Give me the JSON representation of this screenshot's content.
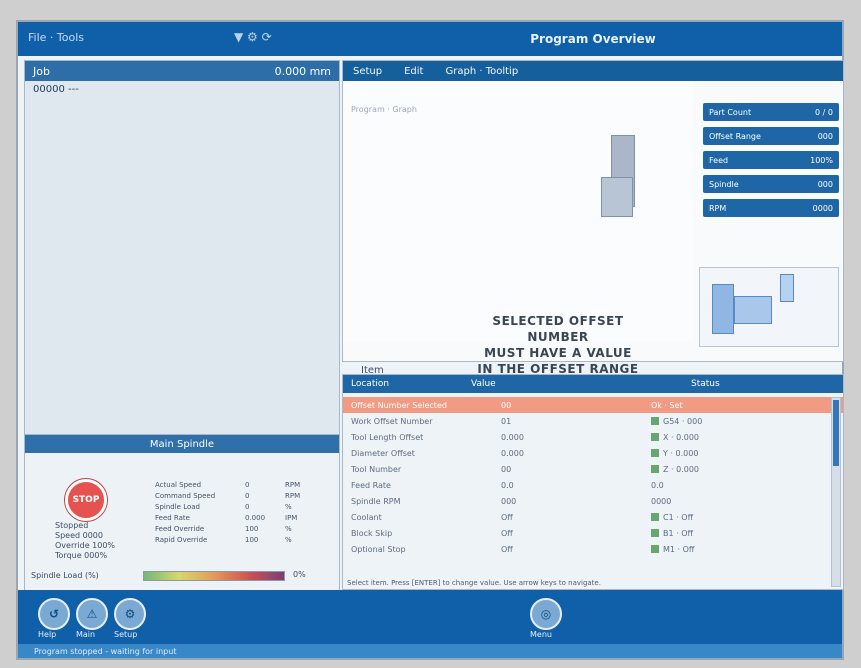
{
  "topbar": {
    "left_label": "File · Tools",
    "icons": "▼ ⚙ ⟳",
    "program_title": "Program Overview"
  },
  "left_panel": {
    "header_left": "Job",
    "header_right": "0.000 mm",
    "sub_label": "00000 ---"
  },
  "tabs": [
    "Setup",
    "Edit",
    "Graph · Tooltip"
  ],
  "program": {
    "corner_label": "Program · Graph",
    "warning_lines": [
      "SELECTED OFFSET NUMBER",
      "MUST HAVE A VALUE",
      "IN THE OFFSET RANGE"
    ],
    "footer_label": "Item"
  },
  "info_items": [
    {
      "k": "Part Count",
      "v": "0 / 0"
    },
    {
      "k": "Offset Range",
      "v": "000"
    },
    {
      "k": "Feed",
      "v": "100%"
    },
    {
      "k": "Spindle",
      "v": "000"
    },
    {
      "k": "RPM",
      "v": "0000"
    }
  ],
  "table": {
    "headers": [
      "Location",
      "Value",
      "Status"
    ],
    "rows": [
      {
        "c1": "Offset Number Selected",
        "c2": "00",
        "c3": "Ok · Set",
        "selected": true,
        "check": false
      },
      {
        "c1": "Work Offset Number",
        "c2": "01",
        "c3": "G54 · 000",
        "selected": false,
        "check": true
      },
      {
        "c1": "Tool Length Offset",
        "c2": "0.000",
        "c3": "X · 0.000",
        "selected": false,
        "check": true
      },
      {
        "c1": "Diameter Offset",
        "c2": "0.000",
        "c3": "Y · 0.000",
        "selected": false,
        "check": true
      },
      {
        "c1": "Tool Number",
        "c2": "00",
        "c3": "Z · 0.000",
        "selected": false,
        "check": true
      },
      {
        "c1": "Feed Rate",
        "c2": "0.0",
        "c3": "0.0",
        "selected": false,
        "check": false
      },
      {
        "c1": "Spindle RPM",
        "c2": "000",
        "c3": "0000",
        "selected": false,
        "check": false
      },
      {
        "c1": "Coolant",
        "c2": "Off",
        "c3": "C1 · Off",
        "selected": false,
        "check": true
      },
      {
        "c1": "Block Skip",
        "c2": "Off",
        "c3": "B1 · Off",
        "selected": false,
        "check": true
      },
      {
        "c1": "Optional Stop",
        "c2": "Off",
        "c3": "M1 · Off",
        "selected": false,
        "check": true
      }
    ],
    "footer_text": "Select item. Press [ENTER] to change value. Use arrow keys to navigate."
  },
  "spindle": {
    "title": "Main Spindle",
    "stop_label": "STOP",
    "left_lines": [
      "Stopped",
      "Speed 0000",
      "Override 100%",
      "Torque 000%"
    ],
    "metrics": [
      [
        "Actual Speed",
        "0",
        "RPM"
      ],
      [
        "Command Speed",
        "0",
        "RPM"
      ],
      [
        "Spindle Load",
        "0",
        "%"
      ],
      [
        "Feed Rate",
        "0.000",
        "IPM"
      ],
      [
        "Feed Override",
        "100",
        "%"
      ],
      [
        "Rapid Override",
        "100",
        "%"
      ]
    ],
    "load_label": "Spindle Load (%)",
    "load_value": "0%"
  },
  "bottom_nav": {
    "buttons": [
      "↺",
      "⚠",
      "⚙",
      "◎"
    ],
    "labels": [
      "Help",
      "Main",
      "Setup",
      "Menu"
    ],
    "status": "Program stopped - waiting for input"
  }
}
